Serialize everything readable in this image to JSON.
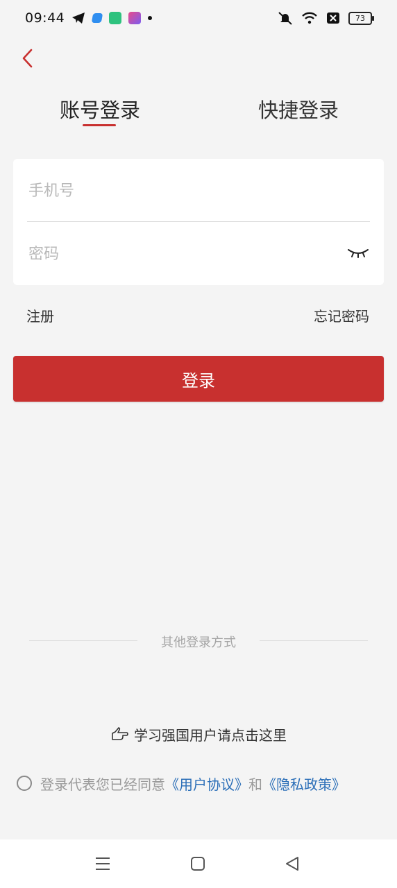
{
  "status_bar": {
    "time": "09:44",
    "battery": "73",
    "icons": [
      "telegram-icon",
      "app-blue-icon",
      "app-green-icon",
      "app-purple-icon",
      "notification-dot-icon",
      "mute-icon",
      "wifi-icon",
      "sim-icon",
      "battery-icon"
    ]
  },
  "header": {
    "back_icon": "chevron-left-icon"
  },
  "tabs": {
    "account_login": "账号登录",
    "quick_login": "快捷登录",
    "active": "account_login",
    "accent_color": "#c8302f"
  },
  "form": {
    "phone_placeholder": "手机号",
    "phone_value": "",
    "password_placeholder": "密码",
    "password_value": "",
    "password_toggle_icon": "eye-closed-icon"
  },
  "links": {
    "register": "注册",
    "forgot_password": "忘记密码"
  },
  "login_button": {
    "label": "登录",
    "color": "#c8302f"
  },
  "other_login": {
    "label": "其他登录方式"
  },
  "xuexi": {
    "icon": "pointing-hand-icon",
    "label": "学习强国用户请点击这里"
  },
  "agreement": {
    "prefix": "登录代表您已经同意",
    "user_agreement": "《用户协议》",
    "and": "和",
    "privacy_policy": "《隐私政策》",
    "checked": false,
    "link_color": "#2c6fb8"
  },
  "nav_bar": {
    "icons": [
      "menu-icon",
      "home-icon",
      "back-triangle-icon"
    ]
  }
}
